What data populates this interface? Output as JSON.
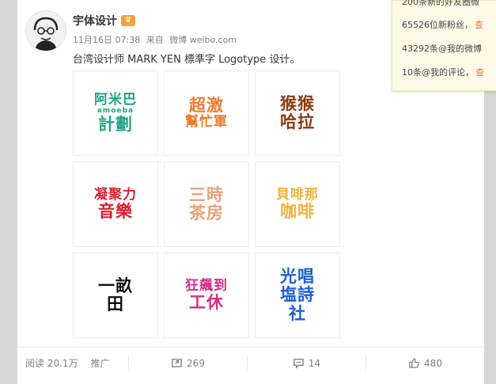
{
  "post": {
    "username": "宇体设计",
    "timestamp": "11月16日 07:38",
    "from_prefix": "来自",
    "source": "微博 weibo.com",
    "text": "台湾设计师 MARK YEN 標準字 Logotype 设计。"
  },
  "grid": {
    "tiles": [
      {
        "lines": [
          "阿米巴",
          "amoeba",
          "計劃"
        ],
        "color": "#22a388"
      },
      {
        "lines": [
          "超激",
          "幫忙軍"
        ],
        "color": "#ef7b2c"
      },
      {
        "lines": [
          "猴猴",
          "哈拉"
        ],
        "color": "#8b3b13"
      },
      {
        "lines": [
          "凝聚力",
          "音樂"
        ],
        "color": "#d92230"
      },
      {
        "lines": [
          "三時",
          "茶房"
        ],
        "color": "#e6a47e"
      },
      {
        "lines": [
          "貝啡那",
          "咖啡"
        ],
        "color": "#f2b13d"
      },
      {
        "lines": [
          "一畝",
          "田"
        ],
        "color": "#111111"
      },
      {
        "lines": [
          "狂飆到",
          "工休"
        ],
        "color": "#d82d8a"
      },
      {
        "lines": [
          "光唱",
          "塩詩",
          "社"
        ],
        "color": "#1c5fd0"
      }
    ]
  },
  "actions": {
    "read_label": "阅读",
    "read_count": "20.1万",
    "promote_label": "推广",
    "reposts": "269",
    "comments": "14",
    "likes": "480"
  },
  "notifications": {
    "row0_text": "200条新的好友圈微",
    "row1_text": "65526位新粉丝，",
    "row1_link": "查",
    "row2_text": "43292条@我的微博",
    "row3_text": "10条@我的评论，",
    "row3_link": "查"
  }
}
